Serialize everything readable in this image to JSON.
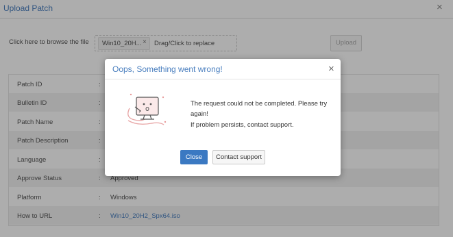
{
  "panel": {
    "title": "Upload Patch",
    "close_glyph": "×",
    "browse_label": "Click here to browse the file",
    "file_name": "Win10_20H...",
    "remove_glyph": "×",
    "drag_text": "Drag/Click to replace",
    "upload_label": "Upload"
  },
  "details": {
    "rows": [
      {
        "label": "Patch ID",
        "colon": ":",
        "value": ""
      },
      {
        "label": "Bulletin ID",
        "colon": ":",
        "value": ""
      },
      {
        "label": "Patch Name",
        "colon": ":",
        "value": ""
      },
      {
        "label": "Patch Description",
        "colon": ":",
        "value": ""
      },
      {
        "label": "Language",
        "colon": ":",
        "value": ""
      },
      {
        "label": "Approve Status",
        "colon": ":",
        "value": "Approved"
      },
      {
        "label": "Platform",
        "colon": ":",
        "value": "Windows"
      },
      {
        "label": "How to URL",
        "colon": ":",
        "value": "Win10_20H2_Spx64.iso"
      }
    ]
  },
  "modal": {
    "title": "Oops, Something went wrong!",
    "close_glyph": "×",
    "message_line1": "The request could not be completed. Please try",
    "message_line2": "again!",
    "message_line3": "If problem persists, contact support.",
    "close_label": "Close",
    "support_label": "Contact support",
    "illustration_icon": "unplugged-monitor-icon"
  },
  "colors": {
    "accent": "#4a7fbf",
    "primary_button": "#3b79c2",
    "alt_row": "#f2f2f2"
  }
}
